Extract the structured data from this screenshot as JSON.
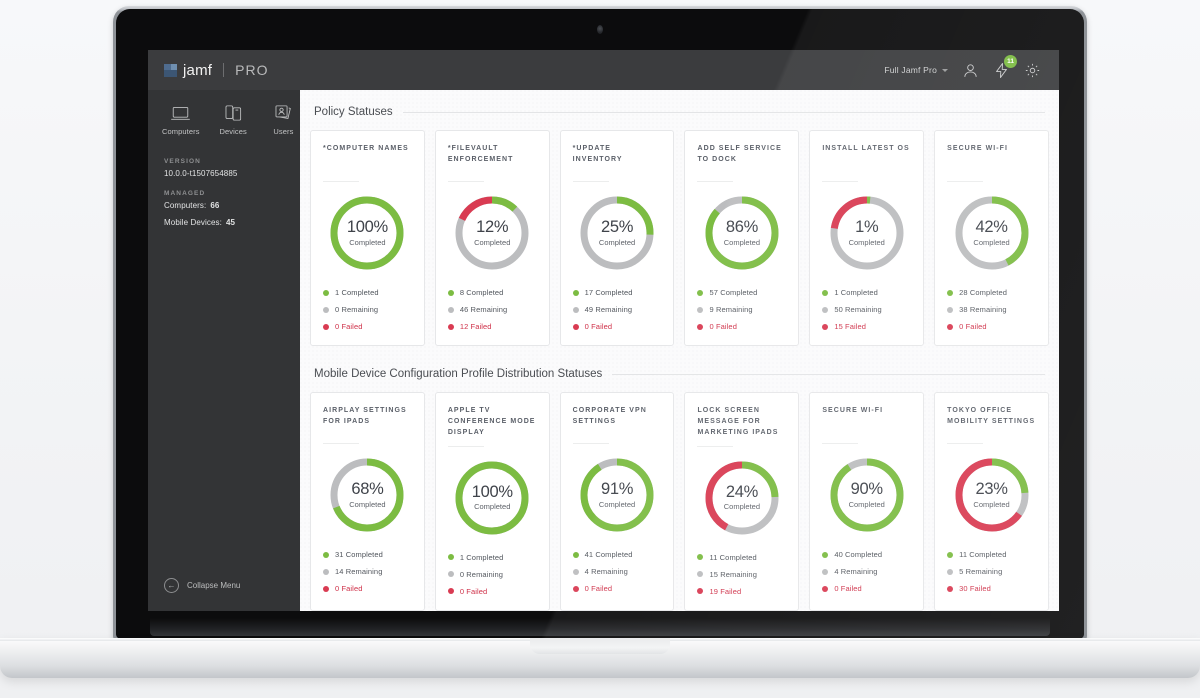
{
  "app": {
    "brand_name": "jamf",
    "brand_suffix": "PRO",
    "brand_mark_icon": "jamf-logo-icon"
  },
  "topbar": {
    "account_label": "Full Jamf Pro",
    "account_caret_icon": "chevron-down-icon",
    "user_icon": "user-icon",
    "notifications_icon": "bolt-icon",
    "notifications_count": "11",
    "settings_icon": "gear-icon",
    "badge_color": "#7cbc42",
    "background": "#3b3c3e"
  },
  "sidebar": {
    "background": "#333436",
    "nav": [
      {
        "label": "Computers",
        "icon": "laptop-icon"
      },
      {
        "label": "Devices",
        "icon": "mobile-devices-icon"
      },
      {
        "label": "Users",
        "icon": "users-icon"
      }
    ],
    "version_label": "VERSION",
    "version_value": "10.0.0-t1507654885",
    "managed_label": "MANAGED",
    "managed": [
      {
        "label": "Computers:",
        "value": "66"
      },
      {
        "label": "Mobile Devices:",
        "value": "45"
      }
    ],
    "collapse_label": "Collapse Menu",
    "collapse_icon": "arrow-left-circle-icon"
  },
  "colors": {
    "completed": "#7cbc42",
    "remaining": "#bcbdbf",
    "failed": "#d93b52",
    "text_dark": "#3f434a"
  },
  "legend_labels": {
    "completed": "Completed",
    "remaining": "Remaining",
    "failed": "Failed"
  },
  "sections": [
    {
      "title": "Policy Statuses",
      "cards": [
        {
          "title": "*COMPUTER NAMES",
          "percent": "100%",
          "percent_value": 100,
          "caption": "Completed",
          "completed": 1,
          "remaining": 0,
          "failed": 0,
          "completed_text": "1 Completed",
          "remaining_text": "0 Remaining",
          "failed_text": "0 Failed"
        },
        {
          "title": "*FILEVAULT ENFORCEMENT",
          "percent": "12%",
          "percent_value": 12,
          "caption": "Completed",
          "completed": 8,
          "remaining": 46,
          "failed": 12,
          "completed_text": "8 Completed",
          "remaining_text": "46 Remaining",
          "failed_text": "12 Failed"
        },
        {
          "title": "*UPDATE INVENTORY",
          "percent": "25%",
          "percent_value": 25,
          "caption": "Completed",
          "completed": 17,
          "remaining": 49,
          "failed": 0,
          "completed_text": "17 Completed",
          "remaining_text": "49 Remaining",
          "failed_text": "0 Failed"
        },
        {
          "title": "ADD SELF SERVICE TO DOCK",
          "percent": "86%",
          "percent_value": 86,
          "caption": "Completed",
          "completed": 57,
          "remaining": 9,
          "failed": 0,
          "completed_text": "57 Completed",
          "remaining_text": "9 Remaining",
          "failed_text": "0 Failed"
        },
        {
          "title": "INSTALL LATEST OS",
          "percent": "1%",
          "percent_value": 1,
          "caption": "Completed",
          "completed": 1,
          "remaining": 50,
          "failed": 15,
          "completed_text": "1 Completed",
          "remaining_text": "50 Remaining",
          "failed_text": "15 Failed"
        },
        {
          "title": "SECURE WI-FI",
          "percent": "42%",
          "percent_value": 42,
          "caption": "Completed",
          "completed": 28,
          "remaining": 38,
          "failed": 0,
          "completed_text": "28 Completed",
          "remaining_text": "38 Remaining",
          "failed_text": "0 Failed"
        }
      ]
    },
    {
      "title": "Mobile Device Configuration Profile Distribution Statuses",
      "cards": [
        {
          "title": "AIRPLAY SETTINGS FOR IPADS",
          "percent": "68%",
          "percent_value": 68,
          "caption": "Completed",
          "completed": 31,
          "remaining": 14,
          "failed": 0,
          "completed_text": "31 Completed",
          "remaining_text": "14 Remaining",
          "failed_text": "0 Failed"
        },
        {
          "title": "APPLE TV CONFERENCE MODE DISPLAY",
          "percent": "100%",
          "percent_value": 100,
          "caption": "Completed",
          "completed": 1,
          "remaining": 0,
          "failed": 0,
          "completed_text": "1 Completed",
          "remaining_text": "0 Remaining",
          "failed_text": "0 Failed"
        },
        {
          "title": "CORPORATE VPN SETTINGS",
          "percent": "91%",
          "percent_value": 91,
          "caption": "Completed",
          "completed": 41,
          "remaining": 4,
          "failed": 0,
          "completed_text": "41 Completed",
          "remaining_text": "4 Remaining",
          "failed_text": "0 Failed"
        },
        {
          "title": "LOCK SCREEN MESSAGE FOR MARKETING IPADS",
          "percent": "24%",
          "percent_value": 24,
          "caption": "Completed",
          "completed": 11,
          "remaining": 15,
          "failed": 19,
          "completed_text": "11 Completed",
          "remaining_text": "15 Remaining",
          "failed_text": "19 Failed"
        },
        {
          "title": "SECURE WI-FI",
          "percent": "90%",
          "percent_value": 90,
          "caption": "Completed",
          "completed": 40,
          "remaining": 4,
          "failed": 0,
          "completed_text": "40 Completed",
          "remaining_text": "4 Remaining",
          "failed_text": "0 Failed"
        },
        {
          "title": "TOKYO OFFICE MOBILITY SETTINGS",
          "percent": "23%",
          "percent_value": 23,
          "caption": "Completed",
          "completed": 11,
          "remaining": 5,
          "failed": 30,
          "completed_text": "11 Completed",
          "remaining_text": "5 Remaining",
          "failed_text": "30 Failed"
        }
      ]
    }
  ]
}
